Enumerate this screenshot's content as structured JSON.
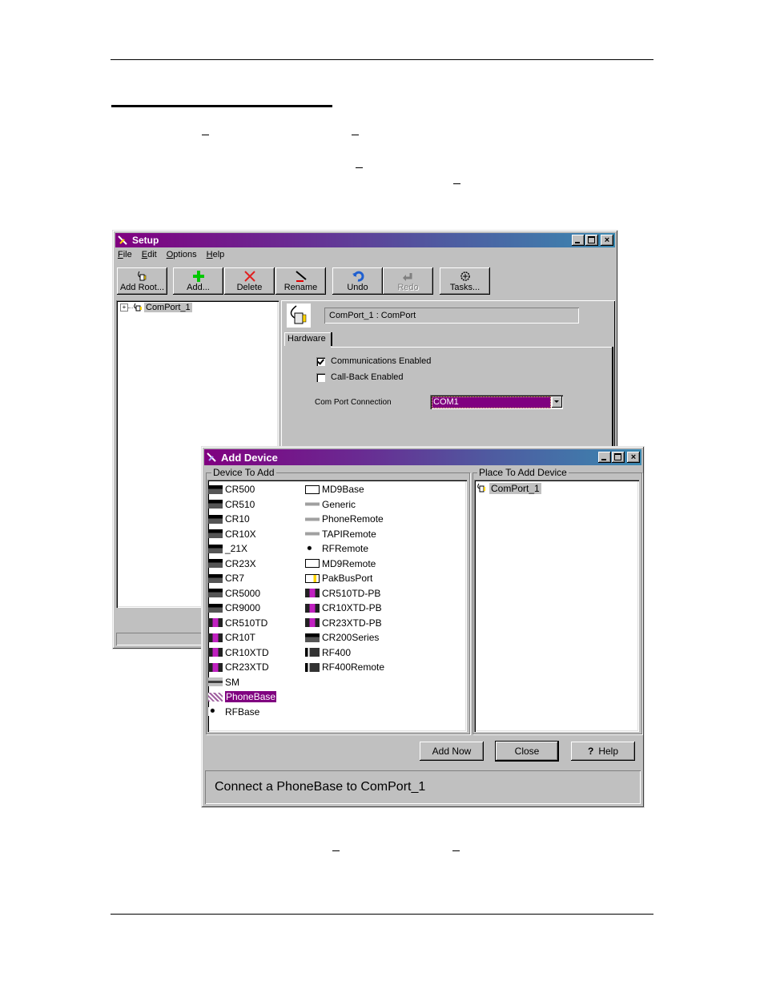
{
  "document": {
    "top_rule": true,
    "section_underline": true,
    "bottom_rule": true
  },
  "setup_window": {
    "title": "Setup",
    "menu": [
      {
        "label": "File",
        "accel": "F"
      },
      {
        "label": "Edit",
        "accel": "E"
      },
      {
        "label": "Options",
        "accel": "O"
      },
      {
        "label": "Help",
        "accel": "H"
      }
    ],
    "toolbar": [
      {
        "label": "Add Root...",
        "icon": "comport-icon",
        "enabled": true
      },
      {
        "label": "Add...",
        "icon": "plus-icon",
        "enabled": true
      },
      {
        "label": "Delete",
        "icon": "x-icon",
        "enabled": true
      },
      {
        "label": "Rename",
        "icon": "rename-icon",
        "enabled": true
      },
      {
        "label": "Undo",
        "icon": "undo-icon",
        "enabled": true
      },
      {
        "label": "Redo",
        "icon": "redo-icon",
        "enabled": false
      },
      {
        "label": "Tasks...",
        "icon": "tasks-icon",
        "enabled": true
      }
    ],
    "tree": {
      "items": [
        {
          "label": "ComPort_1",
          "expander": "+",
          "icon": "comport-icon"
        }
      ]
    },
    "detail": {
      "header_text": "ComPort_1 : ComPort",
      "tab": "Hardware",
      "communications_enabled": {
        "label": "Communications Enabled",
        "checked": true
      },
      "callback_enabled": {
        "label": "Call-Back Enabled",
        "checked": false
      },
      "com_port_label": "Com Port Connection",
      "com_port_value": "COM1"
    },
    "window_buttons": {
      "minimize": "_",
      "maximize": "□",
      "close": "×"
    }
  },
  "add_device_dialog": {
    "title": "Add Device",
    "device_group_label": "Device To Add",
    "place_group_label": "Place To Add Device",
    "devices_col1": [
      {
        "label": "CR500",
        "icon": "datalogger-icon"
      },
      {
        "label": "CR510",
        "icon": "datalogger-icon"
      },
      {
        "label": "CR10",
        "icon": "datalogger-icon"
      },
      {
        "label": "CR10X",
        "icon": "datalogger-icon"
      },
      {
        "label": "_21X",
        "icon": "datalogger-icon"
      },
      {
        "label": "CR23X",
        "icon": "datalogger-icon"
      },
      {
        "label": "CR7",
        "icon": "datalogger-icon"
      },
      {
        "label": "CR5000",
        "icon": "datalogger-icon"
      },
      {
        "label": "CR9000",
        "icon": "datalogger-icon"
      },
      {
        "label": "CR510TD",
        "icon": "td-logger-icon"
      },
      {
        "label": "CR10T",
        "icon": "td-logger-icon"
      },
      {
        "label": "CR10XTD",
        "icon": "td-logger-icon"
      },
      {
        "label": "CR23XTD",
        "icon": "td-logger-icon"
      },
      {
        "label": "SM",
        "icon": "storage-module-icon"
      },
      {
        "label": "PhoneBase",
        "icon": "phone-base-icon",
        "selected": true
      },
      {
        "label": "RFBase",
        "icon": "rf-icon"
      }
    ],
    "devices_col2": [
      {
        "label": "MD9Base",
        "icon": "md9-icon"
      },
      {
        "label": "Generic",
        "icon": "modem-icon"
      },
      {
        "label": "PhoneRemote",
        "icon": "modem-icon"
      },
      {
        "label": "TAPIRemote",
        "icon": "modem-icon"
      },
      {
        "label": "RFRemote",
        "icon": "rf-icon"
      },
      {
        "label": "MD9Remote",
        "icon": "md9-icon"
      },
      {
        "label": "PakBusPort",
        "icon": "comport-icon"
      },
      {
        "label": "CR510TD-PB",
        "icon": "td-logger-icon"
      },
      {
        "label": "CR10XTD-PB",
        "icon": "td-logger-icon"
      },
      {
        "label": "CR23XTD-PB",
        "icon": "td-logger-icon"
      },
      {
        "label": "CR200Series",
        "icon": "datalogger-icon"
      },
      {
        "label": "RF400",
        "icon": "rf400-icon"
      },
      {
        "label": "RF400Remote",
        "icon": "rf400-icon"
      }
    ],
    "place_tree": [
      {
        "label": "ComPort_1",
        "icon": "comport-icon",
        "selected": true
      }
    ],
    "buttons": {
      "add_now": "Add Now",
      "close": "Close",
      "help": "Help"
    },
    "status": "Connect a PhoneBase to ComPort_1"
  },
  "colors": {
    "selection": "#800080",
    "title_start": "#800080",
    "title_end": "#3a88b0",
    "face": "#c0c0c0"
  }
}
